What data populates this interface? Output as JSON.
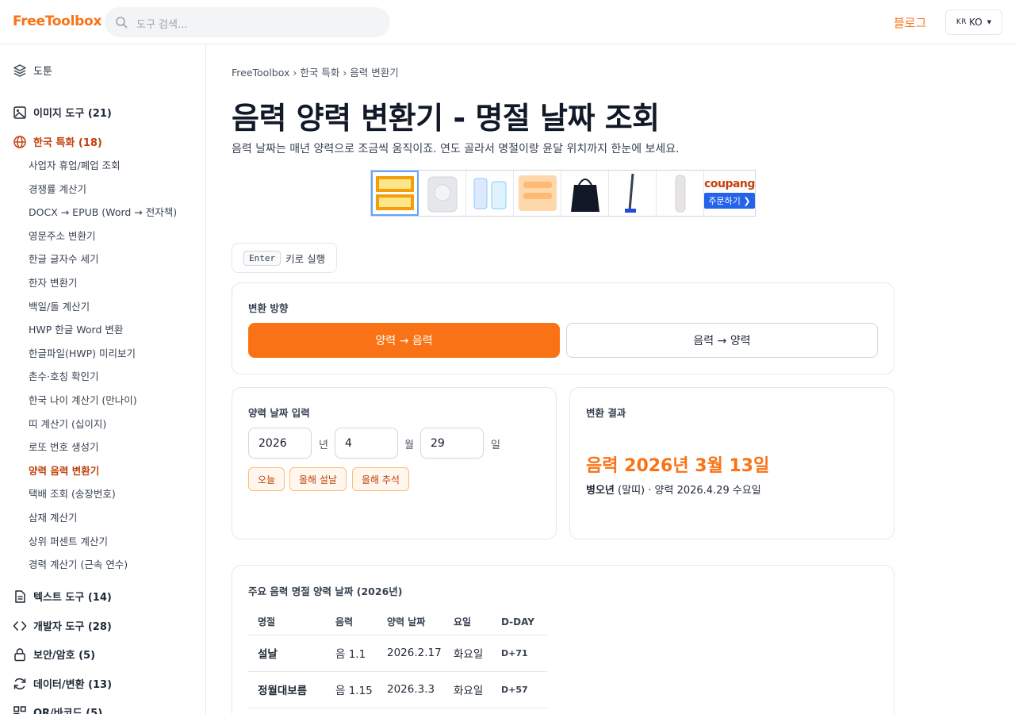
{
  "header": {
    "logo": "FreeToolbox",
    "search_placeholder": "도구 검색...",
    "blog_label": "블로그",
    "lang_flag": "KR",
    "lang_label": "KO"
  },
  "sidebar": {
    "top_item": "도툰",
    "categories": [
      {
        "label": "이미지 도구 (21)",
        "icon": "image-icon"
      },
      {
        "label": "한국 특화 (18)",
        "icon": "globe-icon",
        "active": true
      },
      {
        "label": "텍스트 도구 (14)",
        "icon": "document-icon"
      },
      {
        "label": "개발자 도구 (28)",
        "icon": "code-icon"
      },
      {
        "label": "보안/암호 (5)",
        "icon": "lock-icon"
      },
      {
        "label": "데이터/변환 (13)",
        "icon": "refresh-icon"
      },
      {
        "label": "QR/바코드 (5)",
        "icon": "qr-icon"
      }
    ],
    "sub_items": [
      "사업자 휴업/폐업 조회",
      "경쟁률 계산기",
      "DOCX → EPUB (Word → 전자책)",
      "영문주소 변환기",
      "한글 글자수 세기",
      "한자 변환기",
      "백일/돌 계산기",
      "HWP 한글 Word 변환",
      "한글파일(HWP) 미리보기",
      "촌수·호칭 확인기",
      "한국 나이 계산기 (만나이)",
      "띠 계산기 (십이지)",
      "로또 번호 생성기",
      "양력 음력 변환기",
      "택배 조회 (송장번호)",
      "삼재 계산기",
      "상위 퍼센트 계산기",
      "경력 계산기 (근속 연수)"
    ],
    "active_sub": "양력 음력 변환기"
  },
  "main": {
    "breadcrumb": "FreeToolbox › 한국 특화 › 음력 변환기",
    "title": "음력 양력 변환기 - 명절 날짜 조회",
    "description": "음력 날짜는 매년 양력으로 조금씩 움직이죠. 연도 골라서 명절이랑 윤달 위치까지 한눈에 보세요.",
    "ad": {
      "brand": "coupang",
      "cta": "주문하기 ❯"
    },
    "enter_key": "Enter",
    "enter_hint": "키로 실행",
    "direction": {
      "label": "변환 방향",
      "solar_to_lunar": "양력 → 음력",
      "lunar_to_solar": "음력 → 양력",
      "selected": "양력 → 음력"
    },
    "input": {
      "label": "양력 날짜 입력",
      "year": "2026",
      "year_unit": "년",
      "month": "4",
      "month_unit": "월",
      "day": "29",
      "day_unit": "일",
      "quick": [
        "오늘",
        "올해 설날",
        "올해 추석"
      ]
    },
    "result": {
      "label": "변환 결과",
      "main": "음력 2026년 3월 13일",
      "zodiac": "병오년",
      "zodiac_note": "(말띠)",
      "detail": "· 양력 2026.4.29 수요일"
    },
    "festivals": {
      "title": "주요 음력 명절 양력 날짜 (2026년)",
      "columns": [
        "명절",
        "음력",
        "양력 날짜",
        "요일",
        "D-DAY"
      ],
      "rows": [
        [
          "설날",
          "음 1.1",
          "2026.2.17",
          "화요일",
          "D+71"
        ],
        [
          "정월대보름",
          "음 1.15",
          "2026.3.3",
          "화요일",
          "D+57"
        ]
      ]
    }
  }
}
